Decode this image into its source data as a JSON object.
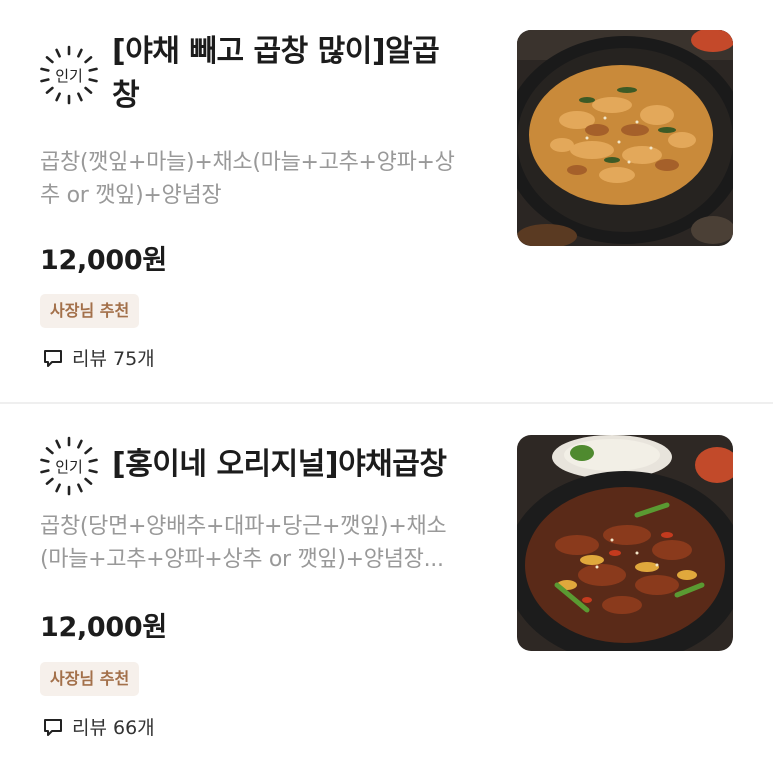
{
  "items": [
    {
      "badge": "인기",
      "title_line1": "[야채 빼고 곱창 많이]알곱",
      "title_line2": "창",
      "desc_line1": "곱창(깻잎+마늘)+채소(마늘+고추+양파+상",
      "desc_line2": "추 or 깻잎)+양념장",
      "price": "12,000원",
      "tag": "사장님 추천",
      "review_label": "리뷰 75개",
      "image_icon": "stir-fried-gopchang-photo"
    },
    {
      "badge": "인기",
      "title_line1": "[홍이네 오리지널]야채곱창",
      "desc_line1": "곱창(당면+양배추+대파+당근+깻잎)+채소",
      "desc_line2": "(마늘+고추+양파+상추 or 깻잎)+양념장...",
      "price": "12,000원",
      "tag": "사장님 추천",
      "review_label": "리뷰 66개",
      "image_icon": "vegetable-gopchang-photo"
    }
  ],
  "colors": {
    "tag_bg": "#f6f0eb",
    "tag_text": "#a3704a",
    "desc_text": "#999999",
    "divider": "#efefef"
  }
}
